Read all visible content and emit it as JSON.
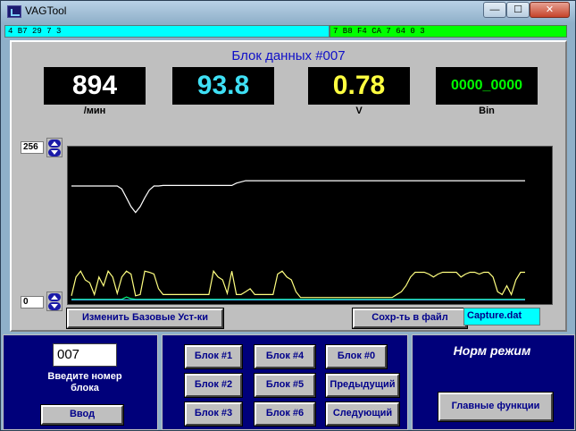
{
  "window": {
    "title": "VAGTool",
    "controls": {
      "minimize": "—",
      "maximize": "☐",
      "close": "✕"
    }
  },
  "status": {
    "left": "4 B7 29 7 3",
    "right": "7 B8 F4 CA 7 64 0 3"
  },
  "main": {
    "block_title": "Блок данных #007",
    "readouts": [
      {
        "value": "894",
        "unit": "/мин",
        "color": "#ffffff"
      },
      {
        "value": "93.8",
        "unit": "",
        "color": "#3fe0f5"
      },
      {
        "value": "0.78",
        "unit": "V",
        "color": "#ffff40"
      },
      {
        "value": "0000_0000",
        "unit": "Bin",
        "color": "#00ff00"
      }
    ],
    "scale_max": "256",
    "scale_min": "0",
    "change_base_button": "Изменить Базовые Уст-ки",
    "save_file_button": "Сохр-ть в файл",
    "capture_file": "Capture.dat"
  },
  "bottom": {
    "block_number": "007",
    "input_label": "Введите номер блока",
    "enter_button": "Ввод",
    "block_buttons": [
      "Блок #1",
      "Блок #2",
      "Блок #3",
      "Блок #4",
      "Блок #5",
      "Блок #6",
      "Блок #0"
    ],
    "prev_button": "Предыдущий",
    "next_button": "Следующий",
    "mode_text": "Норм режим",
    "main_functions_button": "Главные функции"
  },
  "chart_data": {
    "type": "line",
    "ylim": [
      0,
      256
    ],
    "colors": {
      "background": "#000000",
      "series1": "#ffffff",
      "series2": "#ffff80",
      "series3": "#00ff80",
      "series4": "#40c0ff"
    },
    "series": [
      {
        "name": "",
        "values": [
          195,
          195,
          195,
          195,
          195,
          195,
          195,
          195,
          195,
          195,
          195,
          190,
          175,
          160,
          150,
          160,
          175,
          188,
          195,
          195,
          196,
          196,
          196,
          196,
          196,
          196,
          196,
          196,
          196,
          196,
          196,
          196,
          196,
          196,
          196,
          196,
          200,
          202,
          204,
          204,
          204,
          204,
          204,
          204,
          204,
          204,
          204,
          204,
          204,
          204,
          204,
          204,
          204,
          204,
          204,
          204,
          204,
          204,
          204,
          204,
          204,
          204,
          204,
          204,
          204,
          204,
          204,
          204,
          204,
          204,
          204,
          204,
          204,
          204,
          204,
          204,
          204,
          204,
          204,
          204,
          204,
          204,
          204,
          204,
          204,
          204,
          204,
          204,
          204,
          204,
          204,
          204,
          204,
          204,
          204,
          204,
          204,
          204,
          204,
          204
        ]
      },
      {
        "name": "",
        "values": [
          8,
          40,
          50,
          35,
          30,
          10,
          40,
          25,
          50,
          40,
          12,
          40,
          50,
          45,
          8,
          10,
          50,
          48,
          45,
          20,
          10,
          10,
          10,
          10,
          10,
          10,
          10,
          10,
          10,
          10,
          10,
          50,
          40,
          35,
          12,
          50,
          10,
          10,
          15,
          20,
          10,
          10,
          10,
          10,
          10,
          45,
          50,
          40,
          35,
          15,
          5,
          5,
          5,
          5,
          5,
          5,
          5,
          5,
          5,
          5,
          5,
          5,
          5,
          5,
          5,
          5,
          5,
          5,
          5,
          5,
          5,
          10,
          15,
          25,
          40,
          48,
          48,
          48,
          45,
          40,
          45,
          48,
          48,
          48,
          48,
          40,
          45,
          48,
          48,
          45,
          48,
          48,
          40,
          15,
          10,
          25,
          10,
          35,
          48,
          48
        ]
      },
      {
        "name": "",
        "values": [
          2,
          2,
          2,
          2,
          2,
          2,
          2,
          2,
          2,
          2,
          2,
          2,
          6,
          3,
          2,
          2,
          2,
          2,
          2,
          2,
          2,
          2,
          2,
          2,
          2,
          2,
          2,
          2,
          2,
          2,
          2,
          2,
          2,
          2,
          2,
          2,
          2,
          2,
          2,
          2,
          2,
          2,
          2,
          2,
          2,
          2,
          2,
          2,
          2,
          2,
          2,
          2,
          2,
          2,
          2,
          2,
          2,
          2,
          2,
          2,
          2,
          2,
          2,
          2,
          2,
          2,
          2,
          2,
          2,
          2,
          2,
          2,
          2,
          2,
          2,
          2,
          2,
          2,
          2,
          2,
          2,
          2,
          2,
          2,
          2,
          2,
          2,
          2,
          2,
          2,
          2,
          2,
          2,
          2,
          2,
          2,
          2,
          2,
          2,
          2
        ]
      },
      {
        "name": "",
        "values": [
          1,
          1,
          1,
          1,
          1,
          1,
          1,
          1,
          1,
          1,
          1,
          1,
          1,
          1,
          1,
          1,
          1,
          1,
          1,
          1,
          1,
          1,
          1,
          1,
          1,
          1,
          1,
          1,
          1,
          1,
          1,
          1,
          1,
          1,
          1,
          1,
          1,
          1,
          1,
          1,
          1,
          1,
          1,
          1,
          1,
          1,
          1,
          1,
          1,
          1,
          1,
          1,
          1,
          1,
          1,
          1,
          1,
          1,
          1,
          1,
          1,
          1,
          1,
          1,
          1,
          1,
          1,
          1,
          1,
          1,
          1,
          1,
          1,
          1,
          1,
          1,
          1,
          1,
          1,
          1,
          1,
          1,
          1,
          1,
          1,
          1,
          1,
          1,
          1,
          1,
          1,
          1,
          1,
          1,
          1,
          1,
          1,
          1,
          1,
          1
        ]
      }
    ]
  }
}
